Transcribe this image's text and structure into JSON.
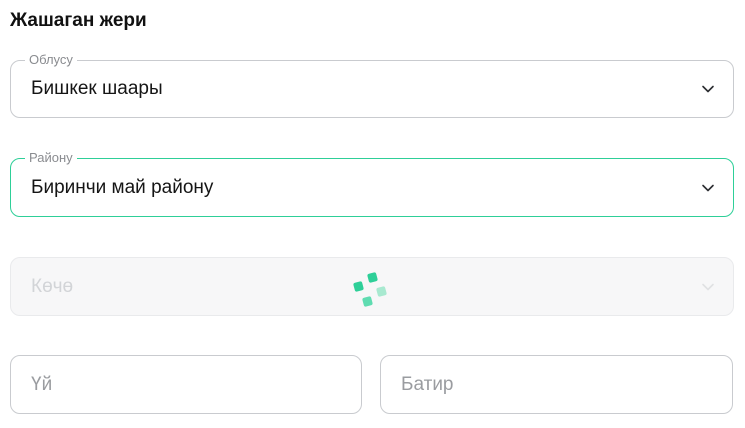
{
  "section": {
    "title": "Жашаган жери"
  },
  "region": {
    "label": "Облусу",
    "value": "Бишкек шаары",
    "icon": "chevron-down-icon"
  },
  "district": {
    "label": "Району",
    "value": "Биринчи май району",
    "icon": "chevron-down-icon"
  },
  "street": {
    "placeholder": "Көчө",
    "icon": "chevron-down-icon",
    "loading_icon": "loading-spinner-icon"
  },
  "house": {
    "placeholder": "Үй"
  },
  "apartment": {
    "placeholder": "Батир"
  },
  "colors": {
    "accent": "#2ecf98",
    "border": "#c9cbcf",
    "text": "#151515",
    "placeholder": "#9a9ca0"
  }
}
